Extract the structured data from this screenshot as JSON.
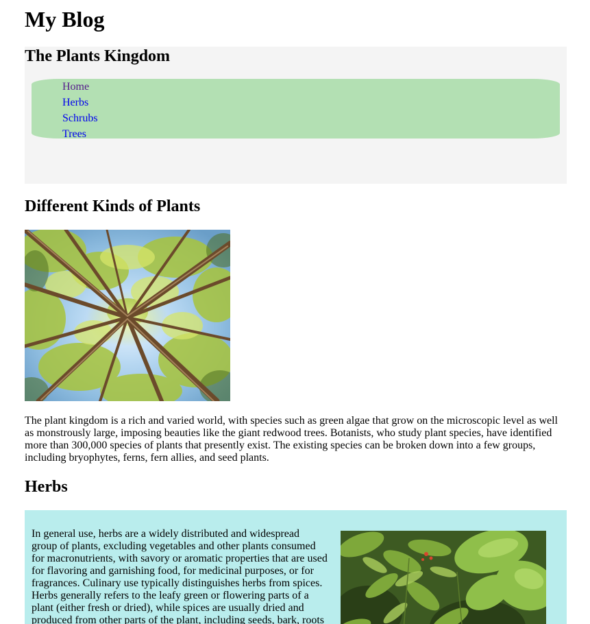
{
  "site": {
    "title": "My Blog"
  },
  "header": {
    "title": "The Plants Kingdom",
    "nav": [
      {
        "label": "Home"
      },
      {
        "label": "Herbs"
      },
      {
        "label": "Schrubs"
      },
      {
        "label": "Trees"
      }
    ]
  },
  "main": {
    "heading": "Different Kinds of Plants",
    "image_description": "forest-canopy-photo",
    "intro": "The plant kingdom is a rich and varied world, with species such as green algae that grow on the microscopic level as well as monstrously large, imposing beauties like the giant redwood trees. Botanists, who study plant species, have identified more than 300,000 species of plants that presently exist. The existing species can be broken down into a few groups, including bryophytes, ferns, fern allies, and seed plants."
  },
  "herbs": {
    "heading": "Herbs",
    "text": "In general use, herbs are a widely distributed and widespread group of plants, excluding vegetables and other plants consumed for macronutrients, with savory or aromatic properties that are used for flavoring and garnishing food, for medicinal purposes, or for fragrances. Culinary use typically distinguishes herbs from spices. Herbs generally refers to the leafy green or flowering parts of a plant (either fresh or dried), while spices are usually dried and produced from other parts of the plant, including seeds, bark, roots"
  },
  "colors": {
    "header_panel_bg": "#f4f4f4",
    "nav_bg": "#b3e0b3",
    "herbs_panel_bg": "#b9eded",
    "link": "#0000ee",
    "link_visited": "#551a8b"
  }
}
